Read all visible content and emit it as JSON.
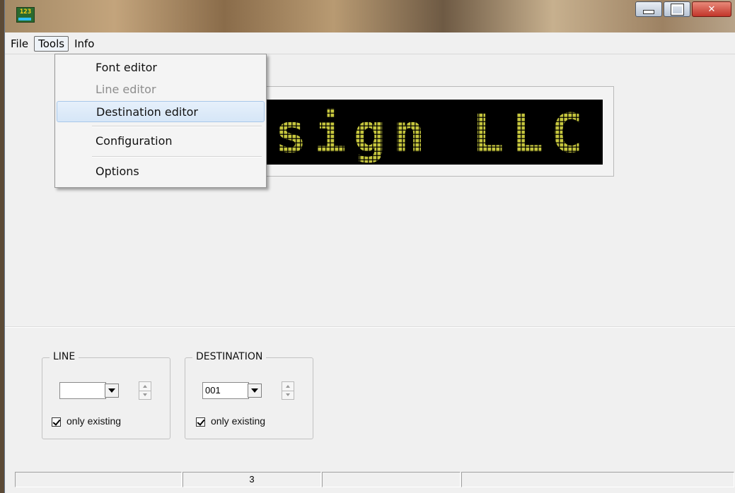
{
  "window": {
    "icon_text": "123",
    "buttons": {
      "minimize": "minimize",
      "maximize": "maximize",
      "close": "close"
    }
  },
  "menubar": {
    "items": [
      "File",
      "Tools",
      "Info"
    ],
    "open_menu": "Tools"
  },
  "tools_menu": {
    "items": [
      {
        "label": "Font editor",
        "enabled": true
      },
      {
        "label": "Line editor",
        "enabled": false
      },
      {
        "label": "Destination editor",
        "enabled": true,
        "highlighted": true
      },
      {
        "label": "Configuration",
        "enabled": true
      },
      {
        "label": "Options",
        "enabled": true
      }
    ]
  },
  "display": {
    "text": "nsign LLC",
    "color": "#c6c63e"
  },
  "line_group": {
    "title": "LINE",
    "combo_value": "",
    "checkbox_label": "only existing",
    "checked": true
  },
  "destination_group": {
    "title": "DESTINATION",
    "combo_value": "001",
    "checkbox_label": "only existing",
    "checked": true
  },
  "statusbar": {
    "cells": [
      "",
      "3",
      "",
      ""
    ]
  }
}
